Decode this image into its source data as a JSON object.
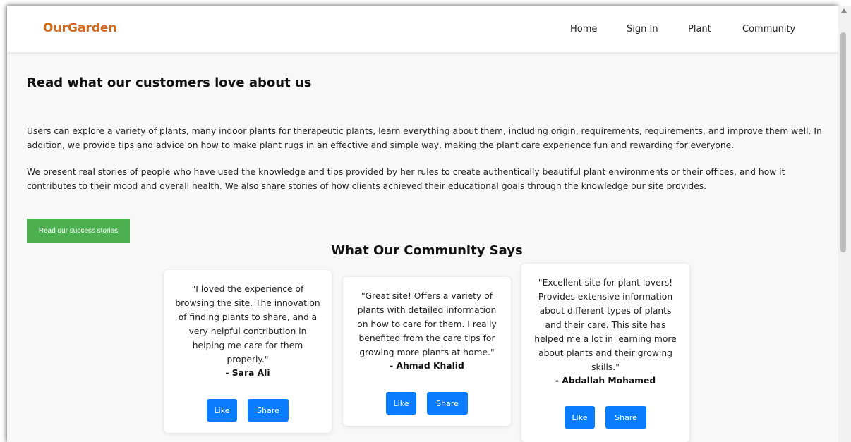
{
  "navbar": {
    "brand": "OurGarden",
    "links": [
      "Home",
      "Sign In",
      "Plant",
      "Community"
    ]
  },
  "intro": {
    "heading": "Read what our customers love about us",
    "paragraph1": "Users can explore a variety of plants, many indoor plants for therapeutic plants, learn everything about them, including origin, requirements, requirements, and improve them well. In addition, we provide tips and advice on how to make plant rugs in an effective and simple way, making the plant care experience fun and rewarding for everyone.",
    "paragraph2": "We present real stories of people who have used the knowledge and tips provided by her rules to create authentically beautiful plant environments or their offices, and how it contributes to their mood and overall health. We also share stories of how clients achieved their educational goals through the knowledge our site provides.",
    "cta_label": "Read our success stories"
  },
  "community": {
    "title": "What Our Community Says",
    "testimonials": [
      {
        "quote": "\"I loved the experience of browsing the site. The innovation of finding plants to share, and a very helpful contribution in helping me care for them properly.\"",
        "author": "- Sara Ali",
        "like_label": "Like",
        "share_label": "Share"
      },
      {
        "quote": "\"Great site! Offers a variety of plants with detailed information on how to care for them. I really benefited from the care tips for growing more plants at home.\"",
        "author": "- Ahmad Khalid",
        "like_label": "Like",
        "share_label": "Share"
      },
      {
        "quote": "\"Excellent site for plant lovers! Provides extensive information about different types of plants and their care. This site has helped me a lot in learning more about plants and their growing skills.\"",
        "author": "- Abdallah Mohamed",
        "like_label": "Like",
        "share_label": "Share"
      }
    ]
  },
  "colors": {
    "brand": "#d2691e",
    "cta": "#4caf50",
    "button": "#0a7cff"
  }
}
